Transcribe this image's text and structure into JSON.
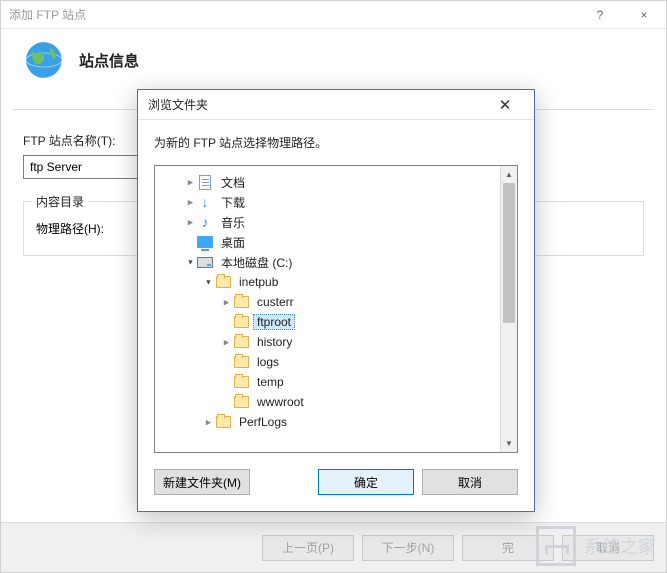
{
  "window": {
    "title": "添加 FTP 站点",
    "help": "?",
    "close": "×",
    "header": "站点信息"
  },
  "form": {
    "site_name_label": "FTP 站点名称(T):",
    "site_name_value": "ftp Server",
    "content_dir_legend": "内容目录",
    "physical_path_label": "物理路径(H):"
  },
  "bottom": {
    "prev": "上一页(P)",
    "next": "下一步(N)",
    "finish": "完",
    "cancel": "取消"
  },
  "dialog": {
    "title": "浏览文件夹",
    "close": "✕",
    "instruction": "为新的 FTP 站点选择物理路径。",
    "new_folder": "新建文件夹(M)",
    "ok": "确定",
    "cancel": "取消"
  },
  "tree": [
    {
      "indent": 1,
      "arrow": "collapsed",
      "icon": "doc",
      "label": "文档"
    },
    {
      "indent": 1,
      "arrow": "collapsed",
      "icon": "dl",
      "label": "下载"
    },
    {
      "indent": 1,
      "arrow": "collapsed",
      "icon": "music",
      "label": "音乐"
    },
    {
      "indent": 1,
      "arrow": "none",
      "icon": "desktop",
      "label": "桌面"
    },
    {
      "indent": 1,
      "arrow": "expanded",
      "icon": "drive",
      "label": "本地磁盘 (C:)"
    },
    {
      "indent": 2,
      "arrow": "expanded",
      "icon": "folder",
      "label": "inetpub"
    },
    {
      "indent": 3,
      "arrow": "collapsed",
      "icon": "folder",
      "label": "custerr"
    },
    {
      "indent": 3,
      "arrow": "none",
      "icon": "folder",
      "label": "ftproot",
      "selected": true
    },
    {
      "indent": 3,
      "arrow": "collapsed",
      "icon": "folder",
      "label": "history"
    },
    {
      "indent": 3,
      "arrow": "none",
      "icon": "folder",
      "label": "logs"
    },
    {
      "indent": 3,
      "arrow": "none",
      "icon": "folder",
      "label": "temp"
    },
    {
      "indent": 3,
      "arrow": "none",
      "icon": "folder",
      "label": "wwwroot"
    },
    {
      "indent": 2,
      "arrow": "collapsed",
      "icon": "folder",
      "label": "PerfLogs"
    }
  ],
  "watermark": "系统之家"
}
